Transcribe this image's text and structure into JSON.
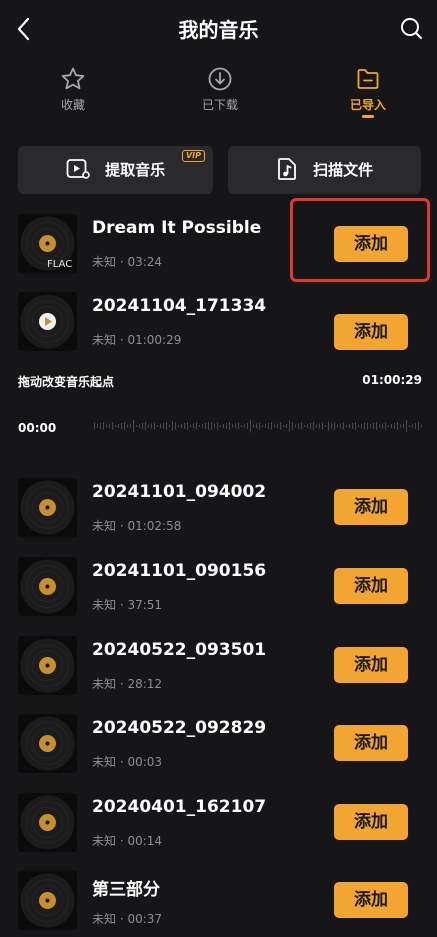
{
  "header": {
    "title": "我的音乐"
  },
  "tabs": [
    {
      "label": "收藏",
      "icon": "star-icon",
      "active": false
    },
    {
      "label": "已下载",
      "icon": "download-icon",
      "active": false
    },
    {
      "label": "已导入",
      "icon": "folder-icon",
      "active": true
    }
  ],
  "actions": {
    "extract": {
      "label": "提取音乐",
      "badge": "VIP"
    },
    "scan": {
      "label": "扫描文件"
    }
  },
  "songs": [
    {
      "title": "Dream It Possible",
      "meta": "未知 · 03:24",
      "format": "FLAC",
      "add_label": "添加"
    },
    {
      "title": "20241104_171334",
      "meta": "未知 · 01:00:29",
      "add_label": "添加",
      "playing": true
    },
    {
      "title": "20241101_094002",
      "meta": "未知 · 01:02:58",
      "add_label": "添加"
    },
    {
      "title": "20241101_090156",
      "meta": "未知 · 37:51",
      "add_label": "添加"
    },
    {
      "title": "20240522_093501",
      "meta": "未知 · 28:12",
      "add_label": "添加"
    },
    {
      "title": "20240522_092829",
      "meta": "未知 · 00:03",
      "add_label": "添加"
    },
    {
      "title": "20240401_162107",
      "meta": "未知 · 00:14",
      "add_label": "添加"
    },
    {
      "title": "第三部分",
      "meta": "未知 · 00:37",
      "add_label": "添加"
    }
  ],
  "trim": {
    "label": "拖动改变音乐起点",
    "duration": "01:00:29",
    "start": "00:00"
  },
  "colors": {
    "background": "#161618",
    "accent": "#f3a532",
    "button_bg": "#2a2a2d",
    "highlight": "#e0392b",
    "muted_text": "#8e8e93"
  }
}
